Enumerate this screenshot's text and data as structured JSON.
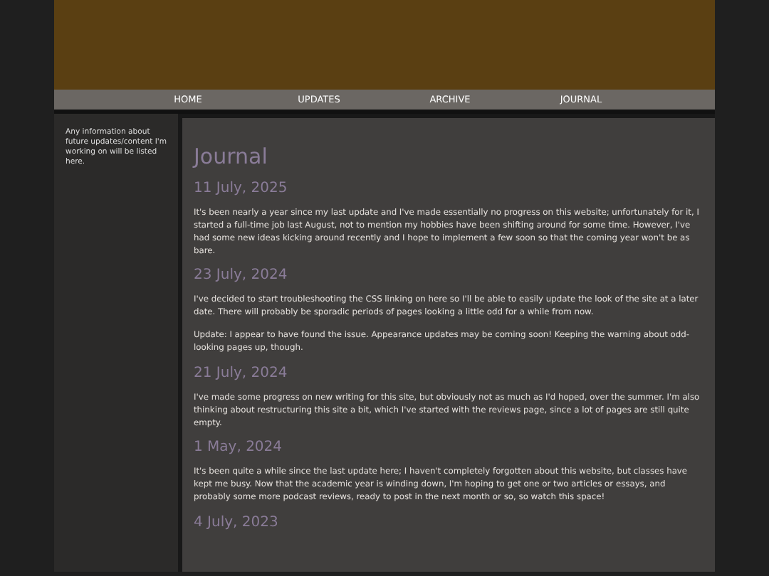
{
  "nav": [
    "HOME",
    "UPDATES",
    "ARCHIVE",
    "JOURNAL"
  ],
  "sidebar": {
    "text": "Any information about future updates/content I'm working on will be listed here."
  },
  "main": {
    "title": "Journal",
    "entries": [
      {
        "date": "11 July, 2025",
        "paragraphs": [
          "It's been nearly a year since my last update and I've made essentially no progress on this website; unfortunately for it, I started a full-time job last August, not to mention my hobbies have been shifting around for some time. However, I've had some new ideas kicking around recently and I hope to implement a few soon so that the coming year won't be as bare."
        ]
      },
      {
        "date": "23 July, 2024",
        "paragraphs": [
          "I've decided to start troubleshooting the CSS linking on here so I'll be able to easily update the look of the site at a later date. There will probably be sporadic periods of pages looking a little odd for a while from now.",
          "Update: I appear to have found the issue. Appearance updates may be coming soon! Keeping the warning about odd-looking pages up, though."
        ]
      },
      {
        "date": "21 July, 2024",
        "paragraphs": [
          "I've made some progress on new writing for this site, but obviously not as much as I'd hoped, over the summer. I'm also thinking about restructuring this site a bit, which I've started with the reviews page, since a lot of pages are still quite empty."
        ]
      },
      {
        "date": "1 May, 2024",
        "paragraphs": [
          "It's been quite a while since the last update here; I haven't completely forgotten about this website, but classes have kept me busy. Now that the academic year is winding down, I'm hoping to get one or two articles or essays, and probably some more podcast reviews, ready to post in the next month or so, so watch this space!"
        ]
      },
      {
        "date": "4 July, 2023"
      }
    ]
  }
}
